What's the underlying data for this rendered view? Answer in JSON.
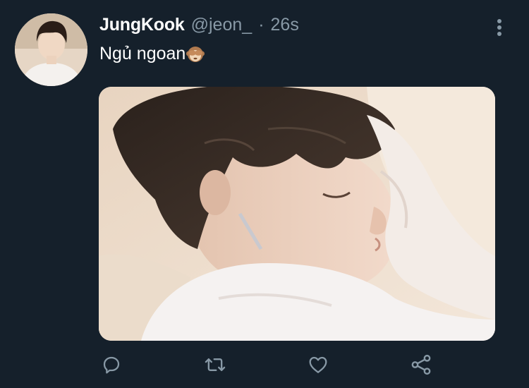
{
  "tweet": {
    "display_name": "JungKook",
    "handle": "@jeon_",
    "separator": "·",
    "timestamp": "26s",
    "text": "Ngủ ngoan",
    "emoji_icon": "see-no-evil-monkey-icon"
  },
  "icons": {
    "more": "more-vertical-icon",
    "reply": "reply-icon",
    "retweet": "retweet-icon",
    "like": "like-icon",
    "share": "share-icon"
  },
  "colors": {
    "background": "#15202b",
    "name": "#ffffff",
    "secondary": "#8899a6"
  }
}
